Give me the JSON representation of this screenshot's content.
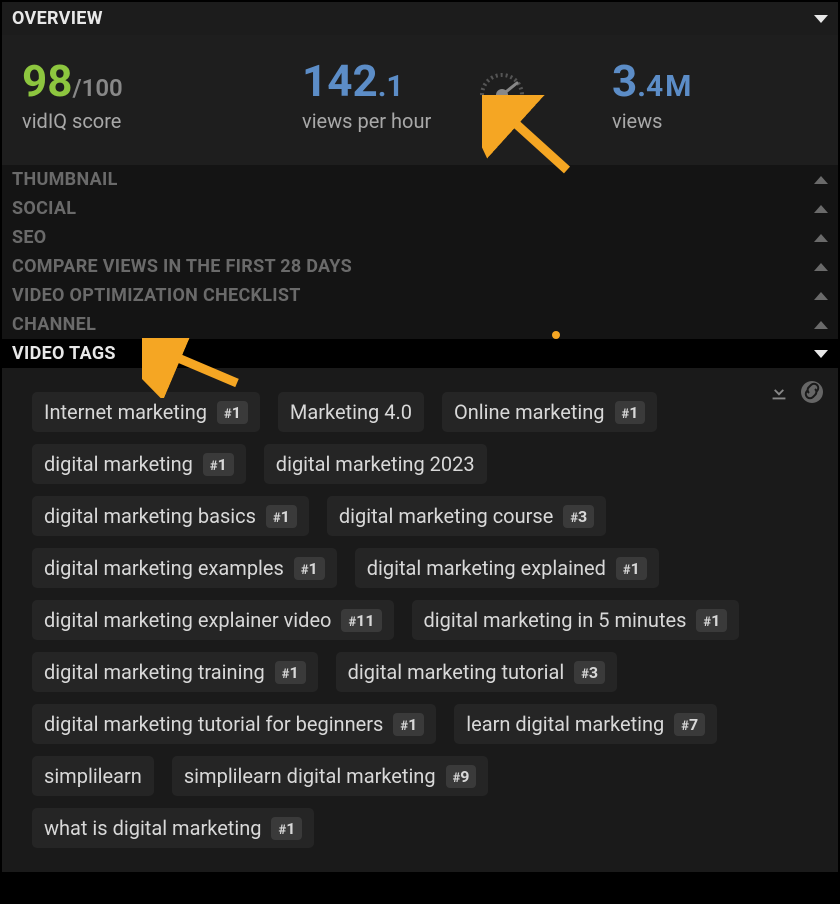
{
  "overview": {
    "header": "OVERVIEW",
    "score": {
      "value": "98",
      "denominator": "/100",
      "label": "vidIQ score"
    },
    "vph": {
      "whole": "142",
      "frac": ".1",
      "label": "views per hour"
    },
    "views": {
      "whole": "3",
      "frac": ".4",
      "unit": "M",
      "label": "views"
    }
  },
  "sections": {
    "thumbnail": "THUMBNAIL",
    "social": "SOCIAL",
    "seo": "SEO",
    "compare": "COMPARE VIEWS IN THE FIRST 28 DAYS",
    "checklist": "VIDEO OPTIMIZATION CHECKLIST",
    "channel": "CHANNEL"
  },
  "videoTags": {
    "header": "VIDEO TAGS",
    "tags": [
      {
        "label": "Internet marketing",
        "rank": "1"
      },
      {
        "label": "Marketing 4.0",
        "rank": null
      },
      {
        "label": "Online marketing",
        "rank": "1"
      },
      {
        "label": "digital marketing",
        "rank": "1"
      },
      {
        "label": "digital marketing 2023",
        "rank": null
      },
      {
        "label": "digital marketing basics",
        "rank": "1"
      },
      {
        "label": "digital marketing course",
        "rank": "3"
      },
      {
        "label": "digital marketing examples",
        "rank": "1"
      },
      {
        "label": "digital marketing explained",
        "rank": "1"
      },
      {
        "label": "digital marketing explainer video",
        "rank": "11"
      },
      {
        "label": "digital marketing in 5 minutes",
        "rank": "1"
      },
      {
        "label": "digital marketing training",
        "rank": "1"
      },
      {
        "label": "digital marketing tutorial",
        "rank": "3"
      },
      {
        "label": "digital marketing tutorial for beginners",
        "rank": "1"
      },
      {
        "label": "learn digital marketing",
        "rank": "7"
      },
      {
        "label": "simplilearn",
        "rank": null
      },
      {
        "label": "simplilearn digital marketing",
        "rank": "9"
      },
      {
        "label": "what is digital marketing",
        "rank": "1"
      }
    ]
  }
}
